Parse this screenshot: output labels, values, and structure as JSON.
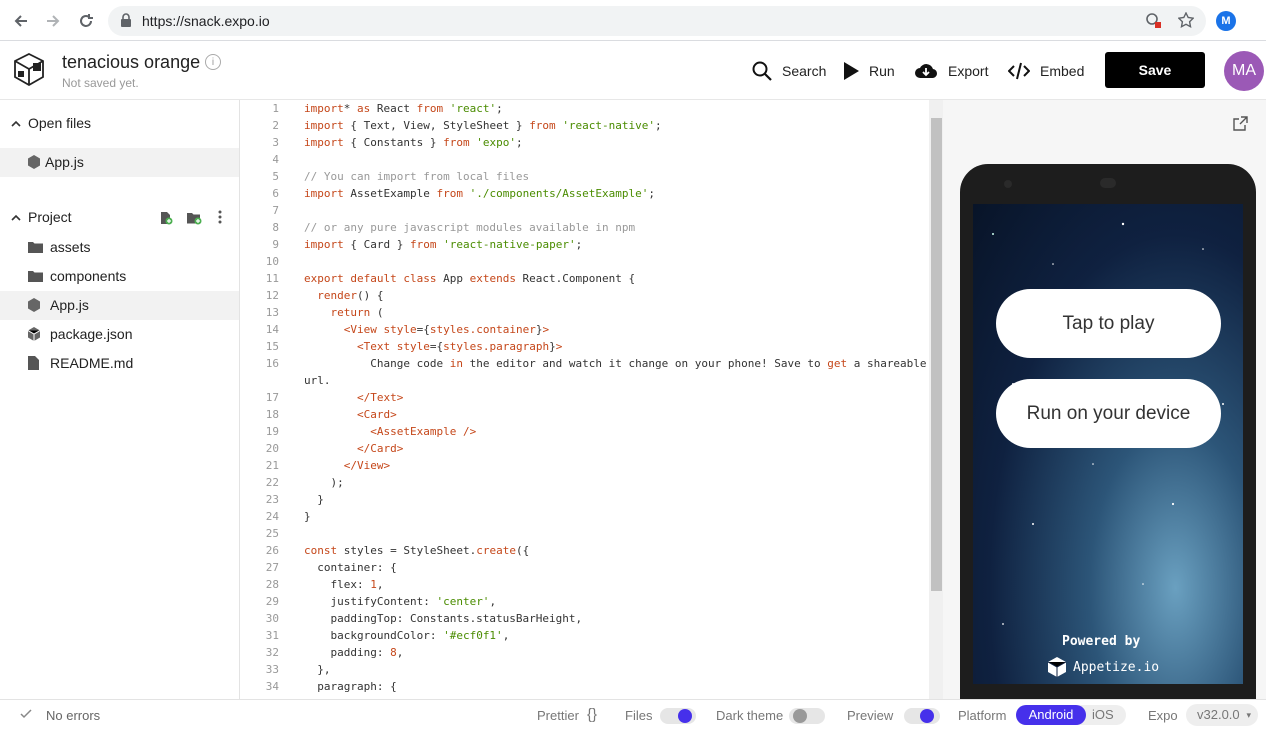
{
  "browser": {
    "url": "https://snack.expo.io",
    "profile_initial": "M"
  },
  "header": {
    "title": "tenacious orange",
    "subtitle": "Not saved yet.",
    "search_label": "Search",
    "run_label": "Run",
    "export_label": "Export",
    "embed_label": "Embed",
    "save_label": "Save",
    "avatar_initials": "MA"
  },
  "sidebar": {
    "open_files_label": "Open files",
    "open_files": [
      "App.js"
    ],
    "project_label": "Project",
    "project_items": [
      {
        "name": "assets",
        "type": "folder"
      },
      {
        "name": "components",
        "type": "folder"
      },
      {
        "name": "App.js",
        "type": "js"
      },
      {
        "name": "package.json",
        "type": "package"
      },
      {
        "name": "README.md",
        "type": "doc"
      }
    ]
  },
  "editor": {
    "line_numbers": [
      "1",
      "2",
      "3",
      "4",
      "5",
      "6",
      "7",
      "8",
      "9",
      "10",
      "11",
      "12",
      "13",
      "14",
      "15",
      "16",
      "",
      "17",
      "18",
      "19",
      "20",
      "21",
      "22",
      "23",
      "24",
      "25",
      "26",
      "27",
      "28",
      "29",
      "30",
      "31",
      "32",
      "33",
      "34"
    ]
  },
  "preview": {
    "tap_to_play": "Tap to play",
    "run_on_device": "Run on your device",
    "powered_by": "Powered by",
    "appetize": "Appetize.io"
  },
  "footer": {
    "status": "No errors",
    "prettier": "Prettier",
    "files": "Files",
    "dark_theme": "Dark theme",
    "preview": "Preview",
    "platform": "Platform",
    "android": "Android",
    "ios": "iOS",
    "expo": "Expo",
    "version": "v32.0.0",
    "accent_color": "#4630eb"
  }
}
